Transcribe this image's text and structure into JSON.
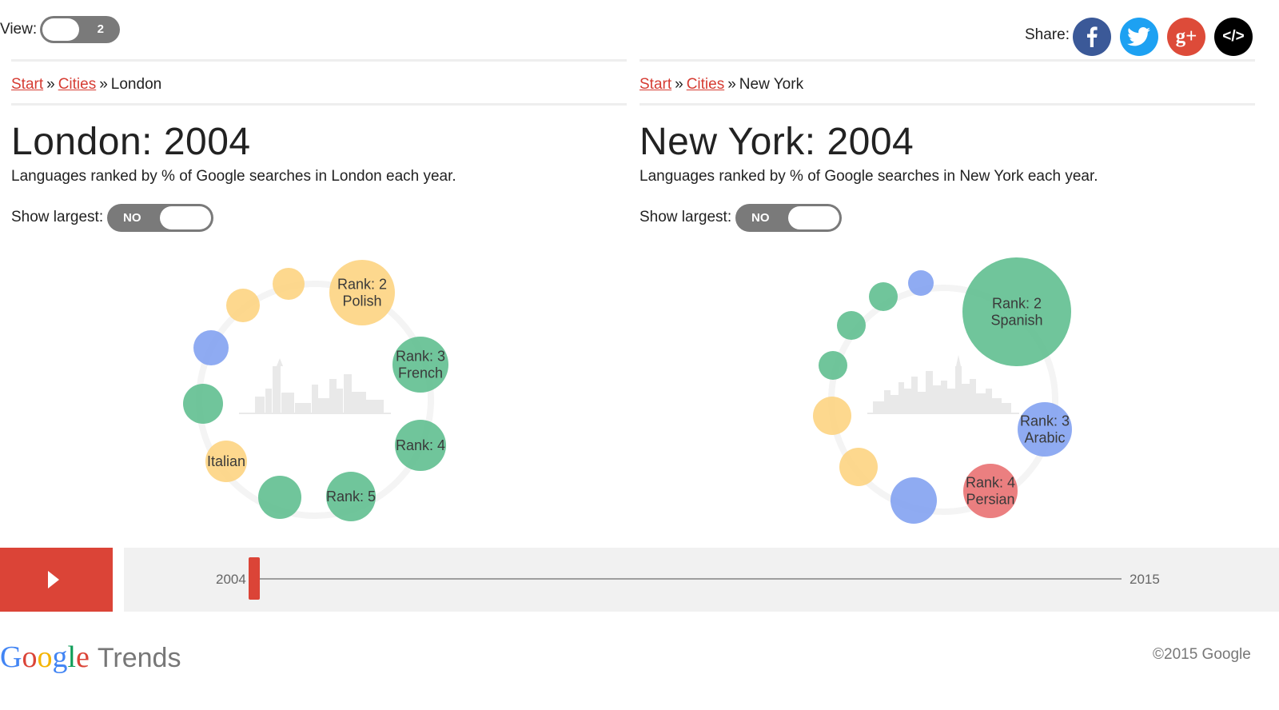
{
  "top": {
    "view_label": "View:",
    "view_value": "2",
    "share_label": "Share:",
    "share_buttons": [
      {
        "name": "facebook",
        "color": "#3b5998"
      },
      {
        "name": "twitter",
        "color": "#1da1f2"
      },
      {
        "name": "google-plus",
        "color": "#dd4b39"
      },
      {
        "name": "embed",
        "color": "#000000"
      }
    ]
  },
  "colors": {
    "yellow": "#fdd17a",
    "green": "#57bb8a",
    "blue": "#7b9cf0",
    "red": "#e8696a",
    "accent": "#db4437",
    "link": "#d63c33"
  },
  "panels": [
    {
      "city": "London",
      "breadcrumb": {
        "start": "Start",
        "cities": "Cities",
        "current": "London"
      },
      "title": "London: 2004",
      "subtitle": "Languages ranked by % of Google searches in London each year.",
      "show_largest_label": "Show largest:",
      "show_largest_value": "NO",
      "bubbles": [
        {
          "color": "yellow",
          "lines": [
            "Rank: 2",
            "Polish"
          ]
        },
        {
          "color": "green",
          "lines": [
            "Rank: 3",
            "French"
          ]
        },
        {
          "color": "green",
          "lines": [
            "Rank: 4"
          ]
        },
        {
          "color": "green",
          "lines": [
            "Rank: 5"
          ]
        },
        {
          "color": "green",
          "lines": []
        },
        {
          "color": "yellow",
          "lines": [
            "Italian"
          ]
        },
        {
          "color": "green",
          "lines": []
        },
        {
          "color": "blue",
          "lines": []
        },
        {
          "color": "yellow",
          "lines": []
        },
        {
          "color": "yellow",
          "lines": []
        }
      ]
    },
    {
      "city": "New York",
      "breadcrumb": {
        "start": "Start",
        "cities": "Cities",
        "current": "New York"
      },
      "title": "New York: 2004",
      "subtitle": "Languages ranked by % of Google searches in New York each year.",
      "show_largest_label": "Show largest:",
      "show_largest_value": "NO",
      "bubbles": [
        {
          "color": "green",
          "lines": [
            "Rank: 2",
            "Spanish"
          ]
        },
        {
          "color": "blue",
          "lines": [
            "Rank: 3",
            "Arabic"
          ]
        },
        {
          "color": "red",
          "lines": [
            "Rank: 4",
            "Persian"
          ]
        },
        {
          "color": "blue",
          "lines": []
        },
        {
          "color": "yellow",
          "lines": []
        },
        {
          "color": "yellow",
          "lines": []
        },
        {
          "color": "green",
          "lines": []
        },
        {
          "color": "green",
          "lines": []
        },
        {
          "color": "green",
          "lines": []
        },
        {
          "color": "blue",
          "lines": []
        }
      ]
    }
  ],
  "timeline": {
    "start_year": "2004",
    "end_year": "2015",
    "current_year": 2004
  },
  "footer": {
    "logo_brand": "Google",
    "logo_product": "Trends",
    "copyright": "©2015 Google"
  }
}
